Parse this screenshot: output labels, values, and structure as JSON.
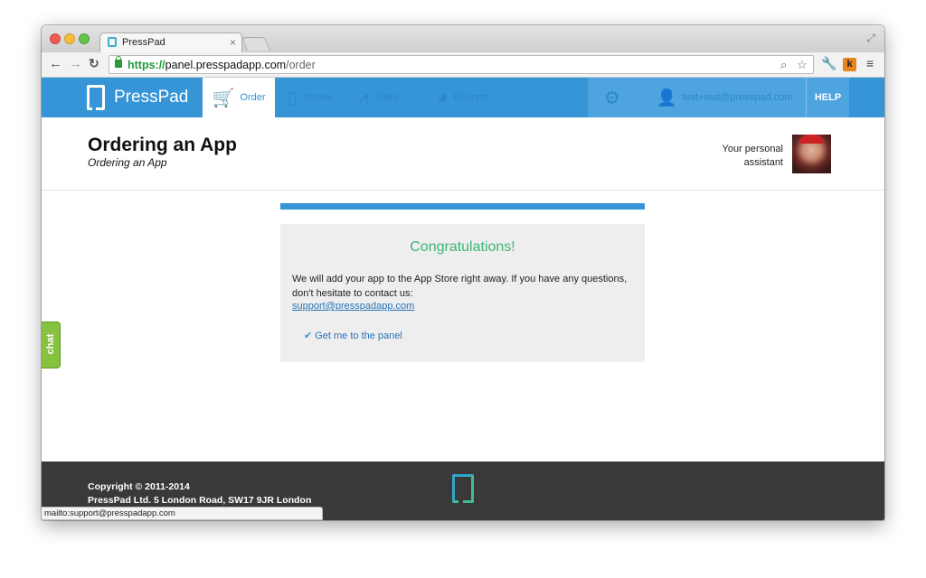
{
  "browser": {
    "tab_title": "PressPad",
    "tab_close": "×",
    "url_scheme": "https://",
    "url_host": "panel.presspadapp.com",
    "url_path": "/order",
    "status_url": "mailto:support@presspadapp.com"
  },
  "nav": {
    "logo": "PressPad",
    "items": [
      {
        "label": "Order",
        "icon": "cart-icon",
        "active": true
      },
      {
        "label": "Issues",
        "icon": "document-icon"
      },
      {
        "label": "Sales",
        "icon": "chart-line-icon"
      },
      {
        "label": "Reports",
        "icon": "pie-chart-icon"
      }
    ],
    "user_email": "test+test@presspad.com",
    "help": "HELP"
  },
  "header": {
    "title": "Ordering an App",
    "subtitle": "Ordering an App",
    "assistant": "Your personal assistant"
  },
  "card": {
    "title": "Congratulations!",
    "message": "We will add your app to the App Store right away. If you have any questions, don't hesitate to contact us:",
    "email": "support@presspadapp.com",
    "panel_link": "Get me to the panel"
  },
  "chat": {
    "label": "chat"
  },
  "footer": {
    "copyright": "Copyright © 2011-2014",
    "address": "PressPad Ltd. 5 London Road, SW17 9JR London"
  },
  "colors": {
    "primary": "#3595d6",
    "success": "#3bb578",
    "chat": "#86c240",
    "footer": "#393939"
  }
}
